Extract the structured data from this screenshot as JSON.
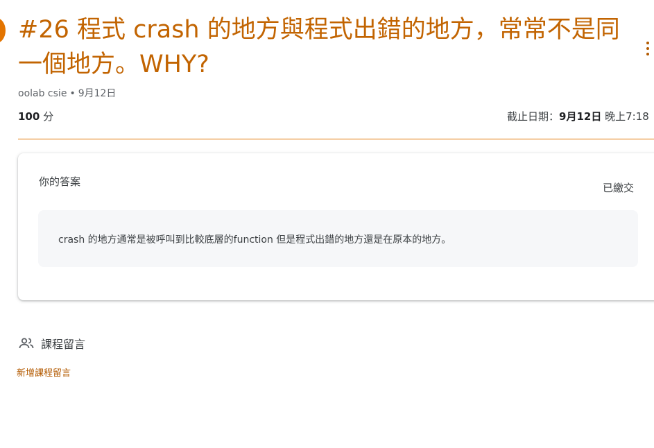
{
  "assignment": {
    "title": "#26 程式 crash 的地方與程式出錯的地方，常常不是同一個地方。WHY?",
    "author": "oolab csie",
    "posted_date": "9月12日",
    "points_value": "100",
    "points_unit": "分",
    "due_label": "截止日期：",
    "due_date": "9月12日",
    "due_time": "晚上7:18",
    "accent_color": "#c26401",
    "icons": {
      "more": "more-vert-icon",
      "assignment": "assignment-icon"
    }
  },
  "your_work": {
    "title": "你的答案",
    "status": "已繳交",
    "answer": "crash 的地方通常是被呼叫到比較底層的function   但是程式出錯的地方還是在原本的地方。"
  },
  "class_comments": {
    "label": "課程留言",
    "add_link": "新增課程留言",
    "icon": "people-icon"
  }
}
